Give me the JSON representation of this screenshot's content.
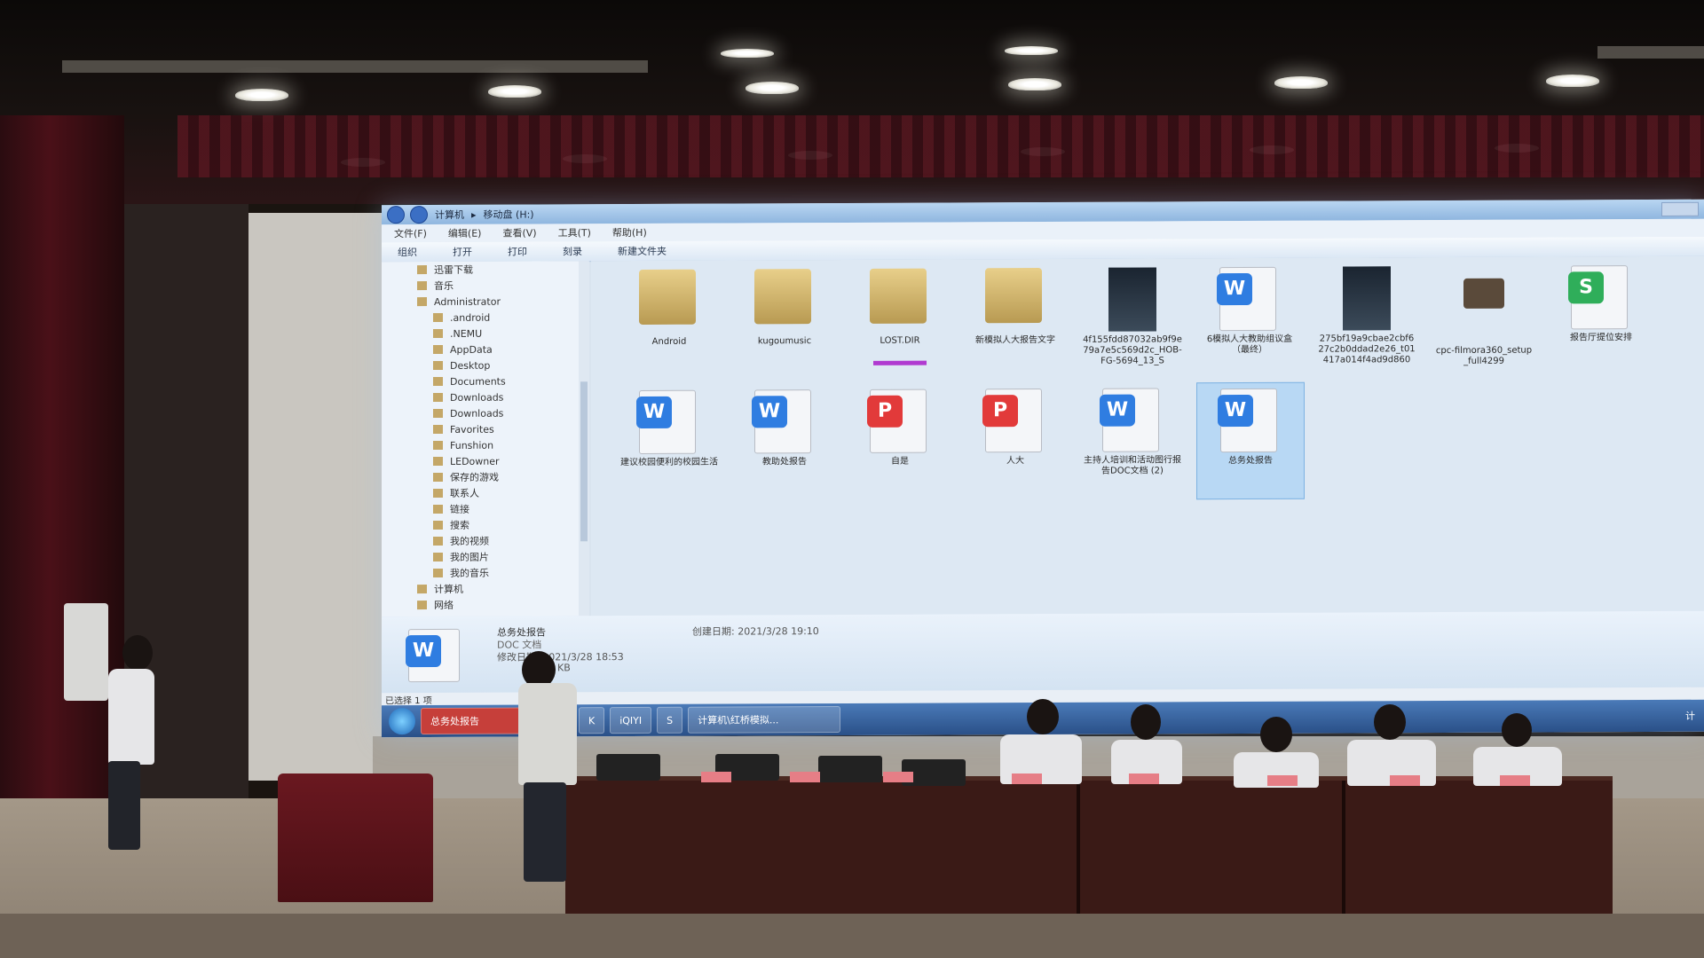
{
  "explorer": {
    "breadcrumb": [
      "计算机",
      "移动盘 (H:)"
    ],
    "menu": [
      "文件(F)",
      "编辑(E)",
      "查看(V)",
      "工具(T)",
      "帮助(H)"
    ],
    "toolbar": [
      "组织",
      "打开",
      "打印",
      "刻录",
      "新建文件夹"
    ],
    "nav_items": [
      "迅雷下载",
      "音乐",
      "Administrator",
      ".android",
      ".NEMU",
      "AppData",
      "Desktop",
      "Documents",
      "Downloads",
      "Downloads",
      "Favorites",
      "Funshion",
      "LEDowner",
      "保存的游戏",
      "联系人",
      "链接",
      "搜索",
      "我的视频",
      "我的图片",
      "我的音乐",
      "计算机",
      "网络"
    ],
    "files": [
      {
        "label": "Android",
        "kind": "folder"
      },
      {
        "label": "kugoumusic",
        "kind": "folder"
      },
      {
        "label": "LOST.DIR",
        "kind": "folder"
      },
      {
        "label": "新模拟人大报告文字",
        "kind": "folder"
      },
      {
        "label": "4f155fdd87032ab9f9e79a7e5c569d2c_HOB-FG-5694_13_S",
        "kind": "image"
      },
      {
        "label": "6模拟人大教助组议盒（最终）",
        "kind": "word",
        "badge": "W"
      },
      {
        "label": "275bf19a9cbae2cbf627c2b0ddad2e26_t01417a014f4ad9d860",
        "kind": "image"
      },
      {
        "label": "cpc-filmora360_setup_full4299",
        "kind": "box"
      },
      {
        "label": "报告厅提位安排",
        "kind": "sheet",
        "badge": "S"
      },
      {
        "label": "建议校园便利的校园生活",
        "kind": "word",
        "badge": "W"
      },
      {
        "label": "教助处报告",
        "kind": "word",
        "badge": "W"
      },
      {
        "label": "自是",
        "kind": "ppt",
        "badge": "P"
      },
      {
        "label": "人大",
        "kind": "ppt",
        "badge": "P"
      },
      {
        "label": "主持人培训和活动图行报告DOC文档 (2)",
        "kind": "word",
        "badge": "W"
      },
      {
        "label": "总务处报告",
        "kind": "word",
        "badge": "W",
        "selected": true
      }
    ],
    "details": {
      "title": "总务处报告",
      "subtitle": "DOC 文档",
      "modified": "修改日期: 2021/3/28 18:53",
      "size": "12.1 KB",
      "created": "创建日期: 2021/3/28 19:10"
    },
    "status": "已选择 1 项",
    "taskbar": {
      "items": [
        "总务处报告",
        "K",
        "iQIYI",
        "S",
        "计算机\\红桥模拟..."
      ],
      "tray": "计"
    }
  },
  "colors": {
    "screen_bg": "#d9e4ef",
    "word_badge": "#2f7de1",
    "ppt_badge": "#e23a3a",
    "sheet_badge": "#2fae5a",
    "taskbar": "#2a5088",
    "stage_curtain": "#5a1620"
  }
}
